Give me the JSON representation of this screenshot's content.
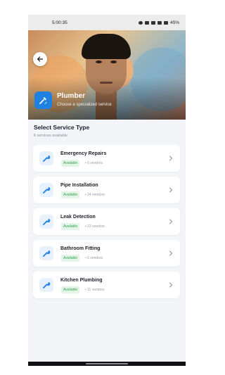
{
  "status_bar": {
    "time": "5:00:35",
    "battery": "45%"
  },
  "header": {
    "title": "Plumber",
    "subtitle": "Choose a specialized service",
    "back_icon": "arrow-left-icon",
    "category_icon": "plumber-icon",
    "accent_color": "#1f82e3"
  },
  "section": {
    "title": "Select Service Type",
    "count_text": "6 services available"
  },
  "services": [
    {
      "name": "Emergency Repairs",
      "status": "Available",
      "vendors": "• 6 vendors"
    },
    {
      "name": "Pipe Installation",
      "status": "Available",
      "vendors": "• 24 vendors"
    },
    {
      "name": "Leak Detection",
      "status": "Available",
      "vendors": "• 23 vendors"
    },
    {
      "name": "Bathroom Fitting",
      "status": "Available",
      "vendors": "• 6 vendors"
    },
    {
      "name": "Kitchen Plumbing",
      "status": "Available",
      "vendors": "• 11 vendors"
    }
  ],
  "service_icon": "wrench-icon",
  "status_color": "#3aa25a"
}
